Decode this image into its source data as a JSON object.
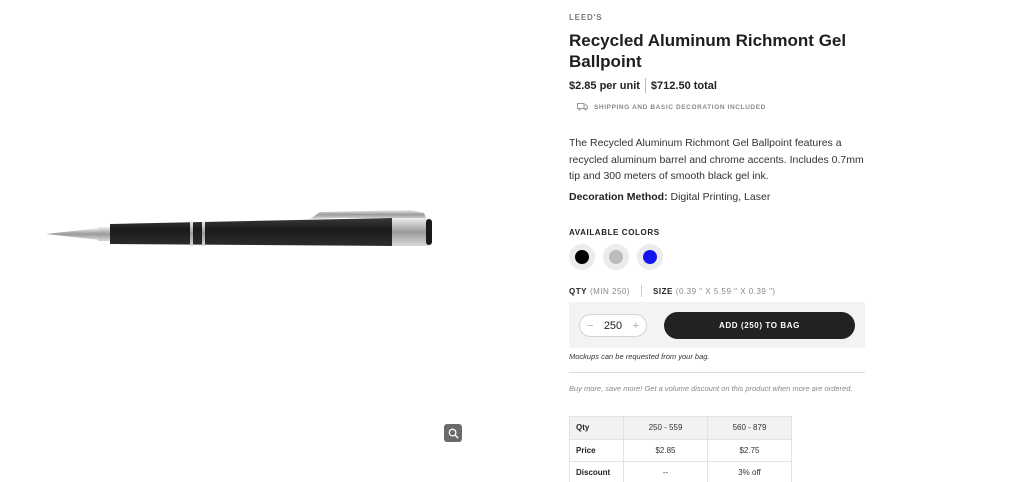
{
  "product": {
    "brand": "LEED'S",
    "title": "Recycled Aluminum Richmont Gel Ballpoint",
    "price_per_unit": "$2.85 per unit",
    "price_total": "$712.50 total",
    "shipping_note": "SHIPPING AND BASIC DECORATION INCLUDED",
    "description": "The Recycled Aluminum Richmont Gel Ballpoint features a recycled aluminum barrel and chrome accents. Includes 0.7mm tip and 300 meters of smooth black gel ink.",
    "decoration_label": "Decoration Method:",
    "decoration_value": "Digital Printing, Laser"
  },
  "colors": {
    "label": "AVAILABLE COLORS",
    "swatches": [
      {
        "name": "Black",
        "hex": "#000000"
      },
      {
        "name": "Silver",
        "hex": "#bdbdbd"
      },
      {
        "name": "Blue",
        "hex": "#1414ee"
      }
    ]
  },
  "order": {
    "qty_label": "QTY",
    "qty_min": "(MIN 250)",
    "size_label": "SIZE",
    "size_value": "(0.39 \" X 5.59 \" X 0.39 \")",
    "quantity": "250",
    "minus": "−",
    "plus": "+",
    "add_button": "ADD (250) TO BAG",
    "mockup_note": "Mockups can be requested from your bag.",
    "buy_more_note": "Buy more, save more! Get a volume discount on this product when more are ordered."
  },
  "volume_table": {
    "rows": [
      {
        "label": "Qty",
        "c1": "250 - 559",
        "c2": "560 - 879"
      },
      {
        "label": "Price",
        "c1": "$2.85",
        "c2": "$2.75"
      },
      {
        "label": "Discount",
        "c1": "--",
        "c2": "3% off"
      }
    ]
  },
  "icons": {
    "zoom": "magnifier-icon",
    "shipping": "truck-icon"
  }
}
